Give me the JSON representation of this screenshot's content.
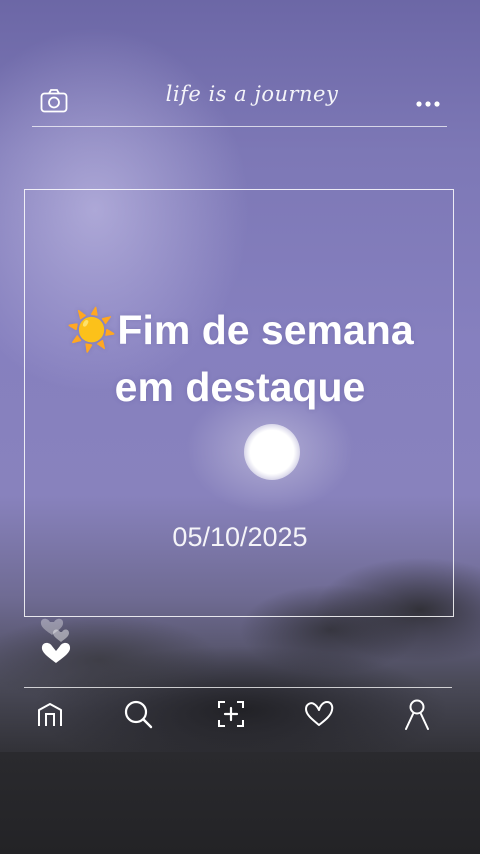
{
  "header": {
    "brand_text": "life is a journey",
    "left_icon": "camera-icon",
    "right_icon": "more-dots-icon"
  },
  "card": {
    "emoji": "☀️",
    "title": "Fim de semana em destaque",
    "date": "05/10/2025"
  },
  "reactions": {
    "icon": "hearts-icon"
  },
  "bottom_nav": {
    "items": [
      {
        "icon": "home-icon"
      },
      {
        "icon": "search-icon"
      },
      {
        "icon": "add-post-icon"
      },
      {
        "icon": "heart-icon"
      },
      {
        "icon": "profile-icon"
      }
    ]
  },
  "colors": {
    "sky": "#8680bf",
    "text": "#ffffff"
  }
}
